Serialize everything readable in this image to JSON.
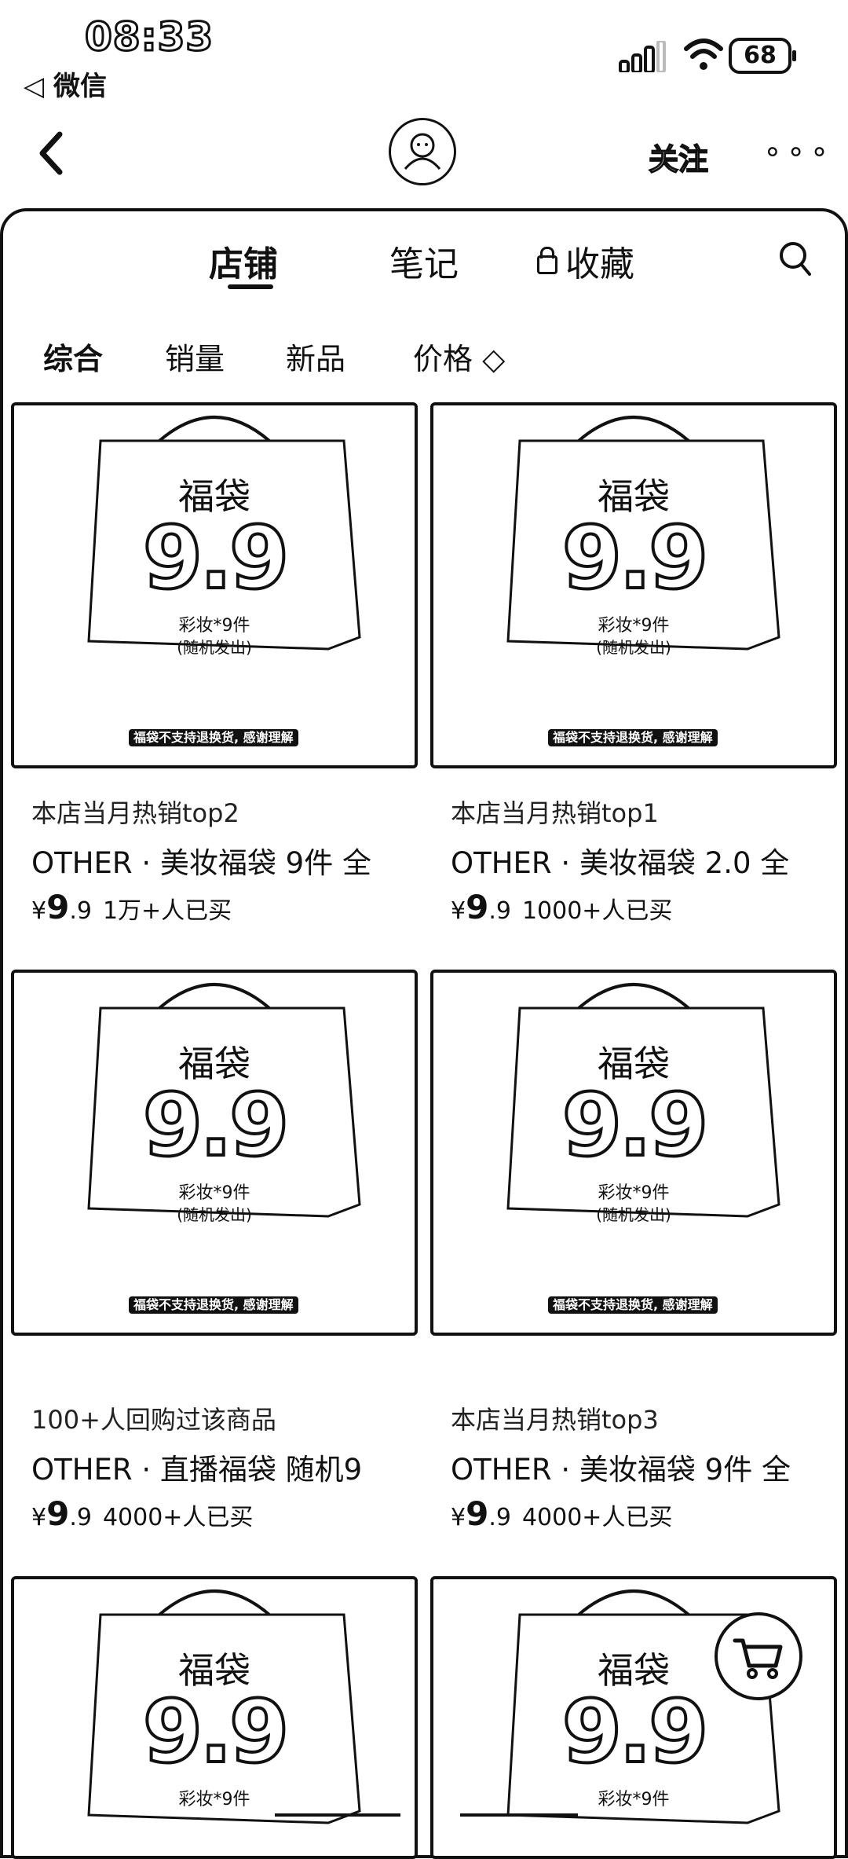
{
  "status": {
    "time": "08:33",
    "back_app": "◁ 微信",
    "battery": "68"
  },
  "header": {
    "follow_label": "关注",
    "more_label": "∘∘∘"
  },
  "tabs": [
    {
      "label": "店铺"
    },
    {
      "label": "笔记"
    },
    {
      "label": "收藏"
    }
  ],
  "filters": [
    {
      "label": "综合"
    },
    {
      "label": "销量"
    },
    {
      "label": "新品"
    },
    {
      "label": "价格 ◇"
    }
  ],
  "bag": {
    "title": "福袋",
    "price": "9.9",
    "sub1": "彩妆*9件",
    "sub2": "(随机发出)",
    "note": "福袋不支持退换货, 感谢理解"
  },
  "products": [
    {
      "tag": "本店当月热销top2",
      "title": "OTHER · 美妆福袋 9件 全",
      "yen": "¥",
      "price_int": "9",
      "price_dec": ".9",
      "sold": "1万+人已买"
    },
    {
      "tag": "本店当月热销top1",
      "title": "OTHER · 美妆福袋 2.0  全",
      "yen": "¥",
      "price_int": "9",
      "price_dec": ".9",
      "sold": "1000+人已买"
    },
    {
      "tag": "100+人回购过该商品",
      "title": "OTHER · 直播福袋 随机9",
      "yen": "¥",
      "price_int": "9",
      "price_dec": ".9",
      "sold": "4000+人已买"
    },
    {
      "tag": "本店当月热销top3",
      "title": "OTHER · 美妆福袋 9件 全",
      "yen": "¥",
      "price_int": "9",
      "price_dec": ".9",
      "sold": "4000+人已买"
    }
  ]
}
